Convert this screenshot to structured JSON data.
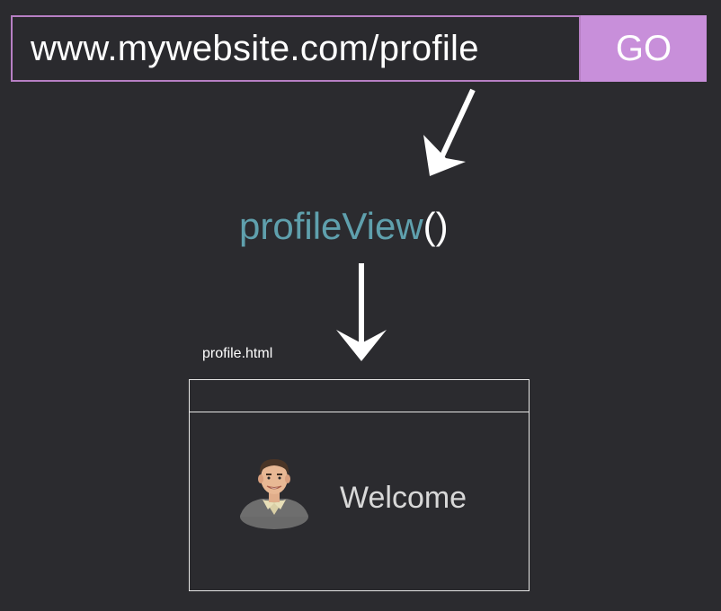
{
  "url_bar": {
    "url": "www.mywebsite.com/profile",
    "go_label": "GO"
  },
  "view": {
    "function_name": "profileView",
    "parens": "()"
  },
  "template": {
    "file_name": "profile.html",
    "welcome_text": "Welcome"
  },
  "colors": {
    "background": "#2b2b2f",
    "accent_purple": "#c88fda",
    "function_teal": "#5fa0ad",
    "frame_white": "#e6e6e6"
  },
  "icons": {
    "avatar": "user-avatar-icon",
    "arrow": "arrow-down-icon"
  }
}
